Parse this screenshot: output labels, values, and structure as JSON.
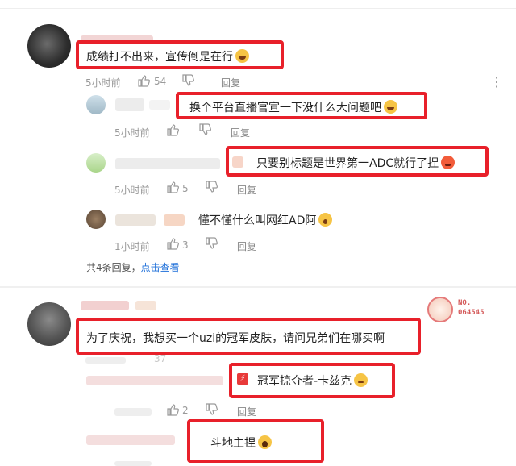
{
  "thread1": {
    "main": {
      "text": "成绩打不出来，宣传倒是在行",
      "emoji": "laugh-emoji",
      "time": "5小时前",
      "likes": "54",
      "reply_label": "回复"
    },
    "replies": [
      {
        "text": "换个平台直播官宣一下没什么大问题吧",
        "emoji": "laugh-emoji",
        "time": "5小时前",
        "likes": "",
        "reply_label": "回复"
      },
      {
        "text": "只要别标题是世界第一ADC就行了捏",
        "emoji": "angry-emoji",
        "time": "5小时前",
        "likes": "5",
        "reply_label": "回复"
      },
      {
        "text": "懂不懂什么叫网红AD阿",
        "emoji": "shock-emoji",
        "time": "1小时前",
        "likes": "3",
        "reply_label": "回复"
      }
    ],
    "summary_prefix": "共4条回复，",
    "summary_link": "点击查看"
  },
  "thread2": {
    "main": {
      "text": "为了庆祝，我想买一个uzi的冠军皮肤，请问兄弟们在哪买啊",
      "likes": "37"
    },
    "badge": "NO.\n064545",
    "replies": [
      {
        "text": "冠军掠夺者-卡兹克",
        "emoji": "wink-emoji",
        "likes": "2",
        "reply_label": "回复"
      },
      {
        "text": "斗地主捏",
        "emoji": "scared-emoji"
      }
    ]
  },
  "colors": {
    "highlight": "#e8202a",
    "link": "#1e6fd9",
    "meta": "#9a9a9a"
  }
}
